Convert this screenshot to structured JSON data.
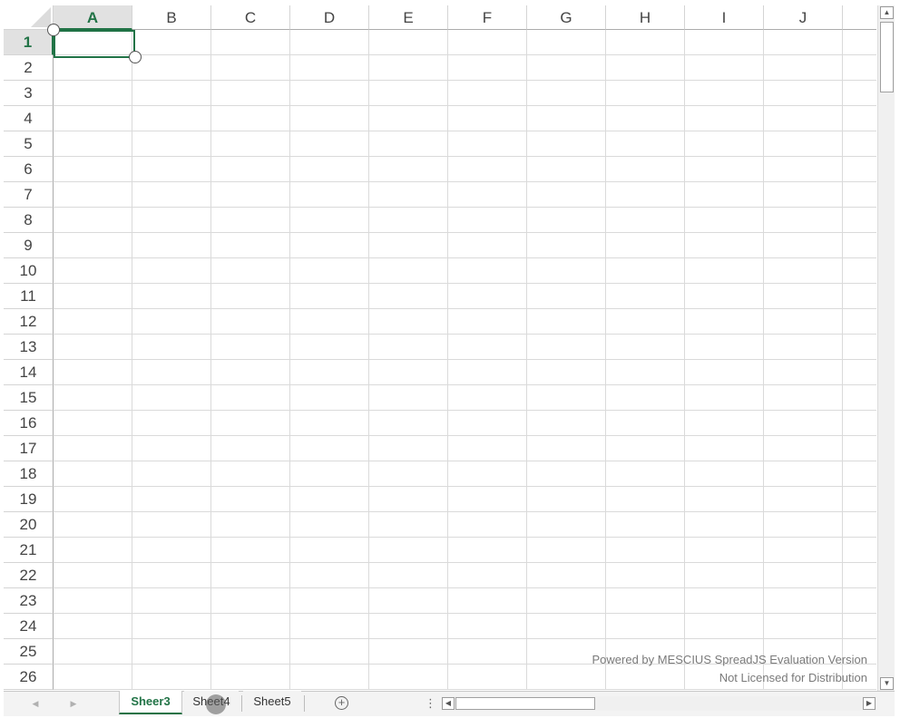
{
  "grid": {
    "columns": [
      "A",
      "B",
      "C",
      "D",
      "E",
      "F",
      "G",
      "H",
      "I",
      "J"
    ],
    "rows": [
      "1",
      "2",
      "3",
      "4",
      "5",
      "6",
      "7",
      "8",
      "9",
      "10",
      "11",
      "12",
      "13",
      "14",
      "15",
      "16",
      "17",
      "18",
      "19",
      "20",
      "21",
      "22",
      "23",
      "24",
      "25",
      "26"
    ],
    "active_cell": "A1"
  },
  "watermark": {
    "line1": "Powered by MESCIUS SpreadJS Evaluation Version",
    "line2": "Not Licensed for Distribution"
  },
  "tabs": [
    {
      "label": "Sheer3",
      "active": true
    },
    {
      "label": "Sheet4",
      "active": false
    },
    {
      "label": "Sheet5",
      "active": false
    }
  ],
  "icons": {
    "add_sheet": "plus-circle-icon",
    "tab_nav_prev": "chevron-left-icon",
    "tab_nav_next": "chevron-right-icon",
    "splitter": "vertical-ellipsis-icon"
  },
  "colors": {
    "accent": "#217346",
    "header_selected_bg": "#e1e1e1",
    "gridline": "#dadada"
  }
}
